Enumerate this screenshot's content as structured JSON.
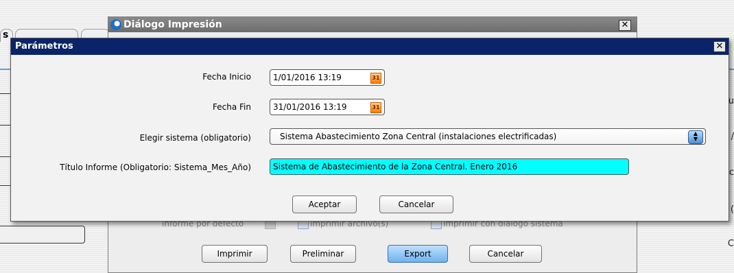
{
  "background": {
    "tab_fragment": "s",
    "right_edge_chars": [
      "u",
      "/",
      "c",
      "(",
      "C"
    ]
  },
  "print_dialog": {
    "title": "Diálogo Impresión",
    "close_symbol": "✕",
    "options": {
      "informe_defecto": "informe por defecto",
      "imprimir_archivo": "imprimir archivo(s)",
      "imprimir_dialogo": "imprimir con diálogo sistema"
    },
    "buttons": {
      "imprimir": "Imprimir",
      "preliminar": "Preliminar",
      "export": "Export",
      "cancelar": "Cancelar"
    }
  },
  "param_dialog": {
    "title": "Parámetros",
    "close_symbol": "✕",
    "fecha_inicio": {
      "label": "Fecha Inicio",
      "value": "1/01/2016 13:19"
    },
    "fecha_fin": {
      "label": "Fecha Fin",
      "value": "31/01/2016 13:19"
    },
    "sistema": {
      "label": "Elegir sistema (obligatorio)",
      "value": "Sistema Abastecimiento Zona Central (instalaciones electrificadas)"
    },
    "titulo": {
      "label": "Título Informe (Obligatorio: Sistema_Mes_Año)",
      "value": "Sistema de Abastecimiento de la Zona Central. Enero 2016"
    },
    "calendar_icon_text": "31",
    "buttons": {
      "aceptar": "Aceptar",
      "cancelar": "Cancelar"
    }
  }
}
